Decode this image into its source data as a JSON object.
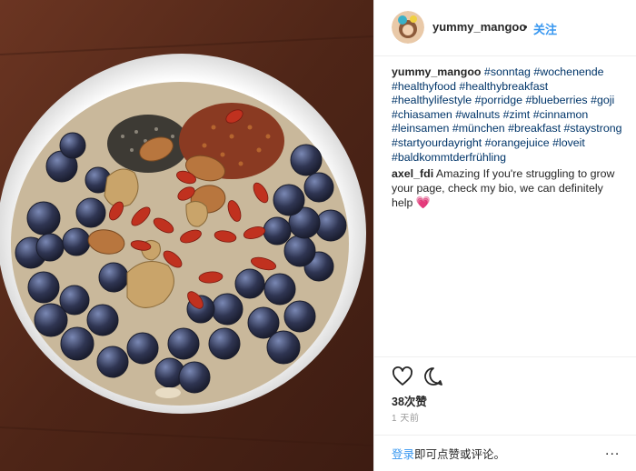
{
  "post": {
    "username": "yummy_mangoo",
    "separator": "•",
    "follow_label": "关注"
  },
  "caption": {
    "username": "yummy_mangoo",
    "hashtags": [
      "#sonntag",
      "#wochenende",
      "#healthyfood",
      "#healthybreakfast",
      "#healthylifestyle",
      "#porridge",
      "#blueberries",
      "#goji",
      "#chiasamen",
      "#walnuts",
      "#zimt",
      "#cinnamon",
      "#leinsamen",
      "#münchen",
      "#breakfast",
      "#staystrong",
      "#startyourdayright",
      "#orangejuice",
      "#loveit",
      "#baldkommtderfrühling"
    ]
  },
  "comment": {
    "username": "axel_fdi",
    "text": "Amazing If you're struggling to grow your page, check my bio, we can definitely help",
    "emoji": "💗"
  },
  "actions": {
    "like_icon": "heart-icon",
    "comment_icon": "comment-icon"
  },
  "likes_text": "38次赞",
  "timestamp": "1 天前",
  "footer": {
    "login_link": "登录",
    "login_rest": "即可点赞或评论。",
    "more_label": "..."
  },
  "colors": {
    "link_blue": "#3897f0",
    "hashtag": "#003569",
    "text": "#262626",
    "muted": "#999999"
  }
}
